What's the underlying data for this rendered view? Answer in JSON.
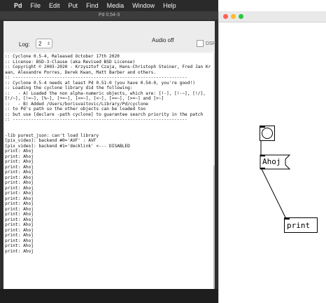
{
  "menubar": {
    "app": "Pd",
    "items": [
      "File",
      "Edit",
      "Put",
      "Find",
      "Media",
      "Window",
      "Help"
    ]
  },
  "pd_window": {
    "title": "Pd 0.54-3",
    "log_label": "Log:",
    "log_value": "2",
    "audio_status": "Audio off",
    "dsp_label": "DSP",
    "console_lines": [
      ":: Cyclone 0.5-4, Released October 17th 2020",
      ":: License: BSD-3-Clause (aka Revised BSD License)",
      ":: Copyright © 2003-2020 - Krzysztof Czaja, Hans-Christoph Steiner, Fred Jan Kraan, Alexandre Porres, Derek Kwan, Matt Barber and others.",
      ":: -------------------------------------------------------------------",
      ":: Cyclone 0.5-4 needs at least Pd 0.51-0 (you have 0.54-0, you're good!)",
      ":: Loading the cyclone library did the following:",
      "::   - A) Loaded the non alpha-numeric objects, which are: [!-], [!-~], [!/], [!/~], [!=~], [%~], [+=~], [<=~], [<~], [==~], [>=~] and [>~]",
      "::   - B) Added /Users/borisvaitovic/Library/Pd/cyclone",
      ":: to Pd's path so the other objects can be loaded too",
      ":: but use [declare -path cyclone] to guarantee search priority in the patch",
      ":: -------------------------------------------------------------------",
      "",
      "",
      "-lib purest_json: can't load library",
      "[pix_video]: backend #0='AVF' : AVF",
      "[pix_video]: backend #1='decklink' <--- DISABLED",
      "print: Ahoj",
      "print: Ahoj",
      "print: Ahoj",
      "print: Ahoj",
      "print: Ahoj",
      "print: Ahoj",
      "print: Ahoj",
      "print: Ahoj",
      "print: Ahoj",
      "print: Ahoj",
      "print: Ahoj",
      "print: Ahoj",
      "print: Ahoj",
      "print: Ahoj",
      "print: Ahoj",
      "print: Ahoj",
      "print: Ahoj",
      "print: Ahoj",
      "print: Ahoj",
      "print: Ahoj"
    ]
  },
  "patch_window": {
    "traffic_lights": [
      "#fe5f57",
      "#febc2e",
      "#28c840"
    ],
    "message_box_text": "Ahoj",
    "print_object_text": "print"
  },
  "colors": {
    "menubar_bg": "#2a2a2a",
    "pd_frame_bg": "#2f2f2f"
  }
}
